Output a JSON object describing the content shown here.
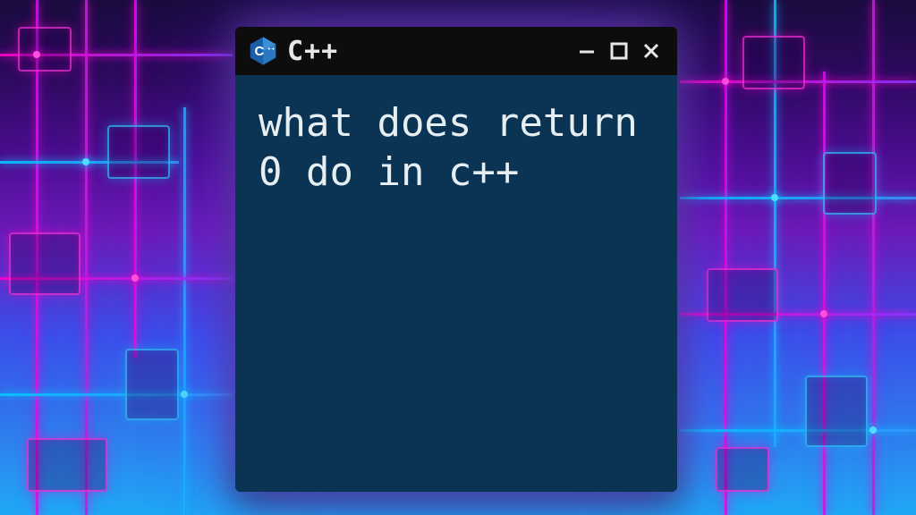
{
  "window": {
    "title": "C++",
    "icon_name": "cpp-icon",
    "content_text": "what does return 0 do in c++"
  },
  "colors": {
    "titlebar_bg": "#0d0d0d",
    "content_bg": "#0a3354",
    "text": "#e6eef2",
    "glow_magenta": "#ff00c8",
    "glow_cyan": "#00c8ff"
  }
}
